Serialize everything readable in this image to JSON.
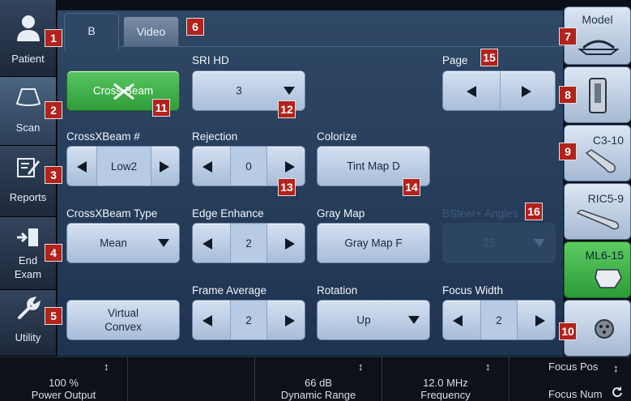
{
  "left_nav": {
    "patient": "Patient",
    "scan": "Scan",
    "reports": "Reports",
    "end_exam_1": "End",
    "end_exam_2": "Exam",
    "utility": "Utility"
  },
  "tabs": {
    "b": "B",
    "video": "Video"
  },
  "controls": {
    "crossbeam_button": "Cross Beam",
    "sri_hd": {
      "label": "SRI HD",
      "value": "3"
    },
    "page": {
      "label": "Page"
    },
    "crossxbeam_num": {
      "label": "CrossXBeam #",
      "value": "Low2"
    },
    "rejection": {
      "label": "Rejection",
      "value": "0"
    },
    "colorize": {
      "label": "Colorize",
      "value": "Tint Map D"
    },
    "crossxbeam_type": {
      "label": "CrossXBeam Type",
      "value": "Mean"
    },
    "edge_enhance": {
      "label": "Edge Enhance",
      "value": "2"
    },
    "gray_map": {
      "label": "Gray Map",
      "value": "Gray Map F"
    },
    "bsteer": {
      "label": "BSteer+ Angles",
      "value": "25"
    },
    "virtual_convex_1": "Virtual",
    "virtual_convex_2": "Convex",
    "frame_average": {
      "label": "Frame Average",
      "value": "2"
    },
    "rotation": {
      "label": "Rotation",
      "value": "Up"
    },
    "focus_width": {
      "label": "Focus Width",
      "value": "2"
    }
  },
  "probes": {
    "model": "Model",
    "c3_10": "C3-10",
    "ric5_9": "RIC5-9",
    "ml6_15": "ML6-15"
  },
  "badges": {
    "b1": "1",
    "b2": "2",
    "b3": "3",
    "b4": "4",
    "b5": "5",
    "b6": "6",
    "b7": "7",
    "b8": "8",
    "b9": "9",
    "b10": "10",
    "b11": "11",
    "b12": "12",
    "b13": "13",
    "b14": "14",
    "b15": "15",
    "b16": "16"
  },
  "bottom_bar": {
    "power_output": {
      "value": "100 %",
      "name": "Power Output"
    },
    "dynamic_range": {
      "value": "66 dB",
      "name": "Dynamic Range"
    },
    "frequency": {
      "value": "12.0 MHz",
      "name": "Frequency"
    },
    "focus_pos": "Focus Pos",
    "focus_num": "Focus Num"
  },
  "colors": {
    "accent_green": "#3fb34a",
    "badge_red": "#b3221b",
    "panel_blue": "#2f4866"
  },
  "icons": [
    "person-icon",
    "probe-scan-icon",
    "report-edit-icon",
    "exit-door-icon",
    "wrench-icon",
    "probe-model-icon",
    "linear-probe-icon",
    "curved-probe-icon",
    "cw-probe-icon",
    "connector-icon",
    "left-arrow-icon",
    "right-arrow-icon",
    "dropdown-arrow-icon",
    "updown-arrow-icon",
    "refresh-icon"
  ]
}
